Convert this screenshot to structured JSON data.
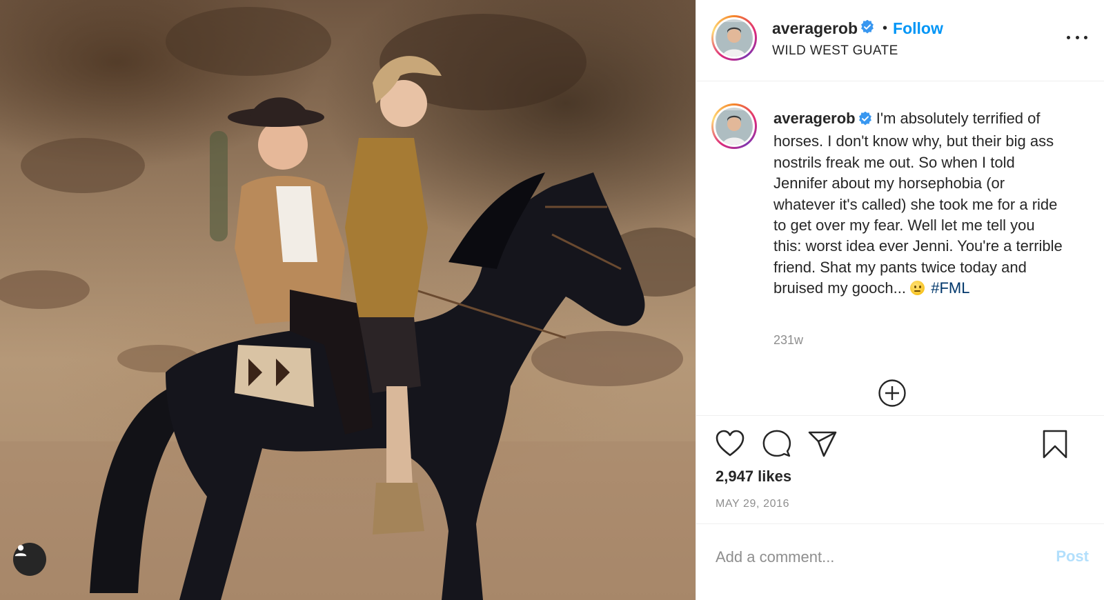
{
  "post": {
    "username": "averagerob",
    "verified": true,
    "follow_separator": "•",
    "follow_label": "Follow",
    "location": "WILD WEST GUATE",
    "caption_text": "I'm absolutely terrified of horses. I don't know why, but their big ass nostrils freak me out. So when I told Jennifer about my horsephobia (or whatever it's called) she took me for a ride to get over my fear. Well let me tell you this: worst idea ever Jenni. You're a terrible friend. Shat my pants twice today and bruised my gooch...",
    "caption_emoji": "neutral-face-emoji",
    "caption_hashtag": "#FML",
    "time_ago": "231w",
    "likes": "2,947 likes",
    "date": "MAY 29, 2016"
  },
  "comment": {
    "placeholder": "Add a comment...",
    "post_label": "Post"
  },
  "icons": {
    "more": "more-options-icon",
    "load_more": "plus-circle-icon",
    "like": "heart-icon",
    "comment": "comment-icon",
    "share": "share-icon",
    "save": "bookmark-icon",
    "user_tags": "user-icon"
  },
  "colors": {
    "accent": "#0095f6",
    "hashtag": "#00376b",
    "muted": "#8e8e8e",
    "post_disabled": "#b2dffc",
    "verified": "#3897f0"
  }
}
